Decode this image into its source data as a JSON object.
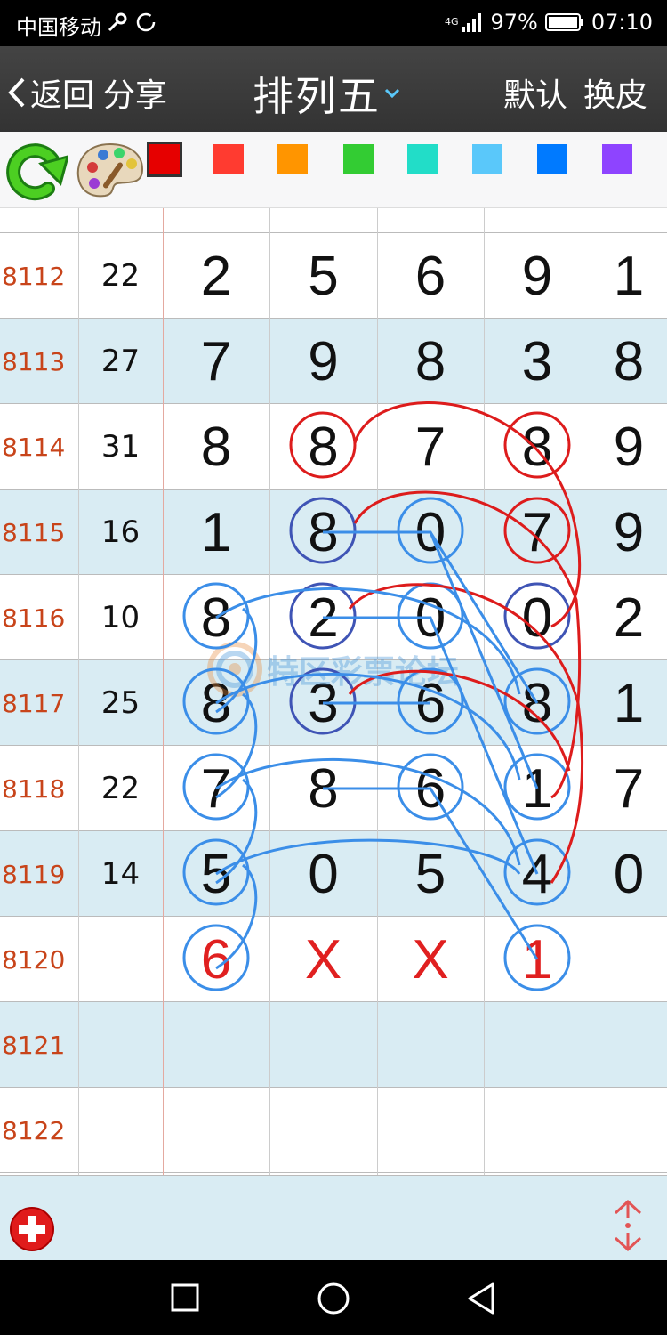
{
  "status_bar": {
    "carrier": "中国移动",
    "network": "4G",
    "battery_pct": "97%",
    "time": "07:10"
  },
  "title_bar": {
    "back_label": "返回",
    "share_label": "分享",
    "title": "排列五",
    "default_label": "默认",
    "skin_label": "换皮"
  },
  "toolbar": {
    "icons": [
      "refresh-icon",
      "palette-icon"
    ],
    "swatches": [
      "#e60000",
      "#ff3b30",
      "#ff9500",
      "#33cc33",
      "#22ddc8",
      "#5ac8fa",
      "#007aff",
      "#8e44ff"
    ],
    "selected_swatch": 0
  },
  "grid": {
    "rows": [
      {
        "issue": "8112",
        "sum": "22",
        "digits": [
          "2",
          "5",
          "6",
          "9",
          "1"
        ]
      },
      {
        "issue": "8113",
        "sum": "27",
        "digits": [
          "7",
          "9",
          "8",
          "3",
          "8"
        ]
      },
      {
        "issue": "8114",
        "sum": "31",
        "digits": [
          "8",
          "8",
          "7",
          "8",
          "9"
        ]
      },
      {
        "issue": "8115",
        "sum": "16",
        "digits": [
          "1",
          "8",
          "0",
          "7",
          "9"
        ]
      },
      {
        "issue": "8116",
        "sum": "10",
        "digits": [
          "8",
          "2",
          "0",
          "0",
          "2"
        ]
      },
      {
        "issue": "8117",
        "sum": "25",
        "digits": [
          "8",
          "3",
          "6",
          "8",
          "1"
        ]
      },
      {
        "issue": "8118",
        "sum": "22",
        "digits": [
          "7",
          "8",
          "6",
          "1",
          "7"
        ]
      },
      {
        "issue": "8119",
        "sum": "14",
        "digits": [
          "5",
          "0",
          "5",
          "4",
          "0"
        ]
      },
      {
        "issue": "8120",
        "sum": "",
        "digits": [
          "6",
          "X",
          "X",
          "1",
          ""
        ]
      },
      {
        "issue": "8121",
        "sum": "",
        "digits": [
          "",
          "",
          "",
          "",
          ""
        ]
      },
      {
        "issue": "8122",
        "sum": "",
        "digits": [
          "",
          "",
          "",
          "",
          ""
        ]
      }
    ],
    "colors": {
      "red_line": "#dd1c1c",
      "blue_line": "#3b8ee8",
      "dark_blue_circle": "#3f54b5",
      "issue_text": "#c8441a",
      "prediction_text": "#e02020",
      "alt_row_bg": "#d9ecf3"
    }
  },
  "watermark": {
    "text": "特区彩票论坛"
  },
  "bottom_bar": {
    "icons": [
      "add-icon",
      "scroll-toggle-icon"
    ]
  },
  "nav_bar": {
    "icons": [
      "recent-apps-icon",
      "home-icon",
      "back-nav-icon"
    ]
  }
}
